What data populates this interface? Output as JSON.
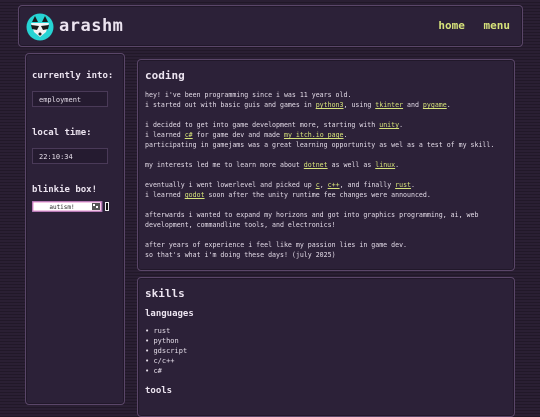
{
  "header": {
    "title": "arashm",
    "nav": {
      "home": "home",
      "menu": "menu"
    }
  },
  "sidebar": {
    "currently_into_label": "currently into:",
    "currently_into_value": "employment",
    "local_time_label": "local time:",
    "local_time_value": "22:10:34",
    "blinkie_label": "blinkie box!",
    "blinkie_text": "autism!"
  },
  "coding": {
    "title": "coding",
    "lines": [
      [
        {
          "t": "hey! i've been programming since i was 11 years old."
        }
      ],
      [
        {
          "t": "i started out with basic guis and games in "
        },
        {
          "t": "python3",
          "l": 1
        },
        {
          "t": ", using "
        },
        {
          "t": "tkinter",
          "l": 1
        },
        {
          "t": " and "
        },
        {
          "t": "pygame",
          "l": 1
        },
        {
          "t": "."
        }
      ],
      [
        {
          "t": ""
        }
      ],
      [
        {
          "t": "i decided to get into game development more, starting with "
        },
        {
          "t": "unity",
          "l": 1
        },
        {
          "t": "."
        }
      ],
      [
        {
          "t": "i learned "
        },
        {
          "t": "c#",
          "l": 1
        },
        {
          "t": " for game dev and made "
        },
        {
          "t": "my itch.io page",
          "l": 1
        },
        {
          "t": "."
        }
      ],
      [
        {
          "t": "participating in gamejams was a great learning opportunity as wel as a test of my skill."
        }
      ],
      [
        {
          "t": ""
        }
      ],
      [
        {
          "t": "my interests led me to learn more about "
        },
        {
          "t": "dotnet",
          "l": 1
        },
        {
          "t": " as well as "
        },
        {
          "t": "linux",
          "l": 1
        },
        {
          "t": "."
        }
      ],
      [
        {
          "t": ""
        }
      ],
      [
        {
          "t": "eventually i went lowerlevel and picked up "
        },
        {
          "t": "c",
          "l": 1
        },
        {
          "t": ", "
        },
        {
          "t": "c++",
          "l": 1
        },
        {
          "t": ", and finally "
        },
        {
          "t": "rust",
          "l": 1
        },
        {
          "t": "."
        }
      ],
      [
        {
          "t": "i learned "
        },
        {
          "t": "godot",
          "l": 1
        },
        {
          "t": " soon after the unity runtime fee changes were announced."
        }
      ],
      [
        {
          "t": ""
        }
      ],
      [
        {
          "t": "afterwards i wanted to expand my horizons and got into graphics programming, ai, web"
        }
      ],
      [
        {
          "t": "development, commandline tools, and electronics!"
        }
      ],
      [
        {
          "t": ""
        }
      ],
      [
        {
          "t": "after years of experience i feel like my passion lies in game dev."
        }
      ],
      [
        {
          "t": "so that's what i'm doing these days! (july 2025)"
        }
      ]
    ]
  },
  "skills": {
    "title": "skills",
    "languages_label": "languages",
    "languages": [
      "rust",
      "python",
      "gdscript",
      "c/c++",
      "c#"
    ],
    "tools_label": "tools"
  },
  "colors": {
    "link": "#d7e37a",
    "background": "#2a1f33",
    "panel": "#2c2138",
    "border": "#5a4668"
  },
  "icons": [
    "raccoon-logo-icon"
  ]
}
